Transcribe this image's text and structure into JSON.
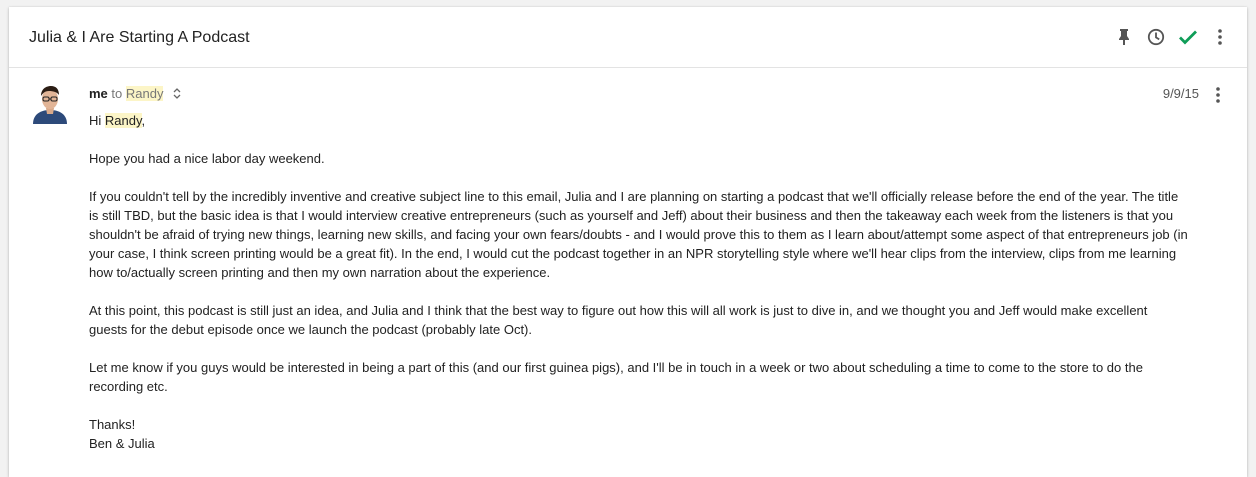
{
  "subject": "Julia & I Are Starting A Podcast",
  "header_actions": [
    "pin-icon",
    "snooze-clock-icon",
    "done-check-icon",
    "more-vert-icon"
  ],
  "colors": {
    "accent_check": "#0f9d58",
    "highlight": "#fcf5c7"
  },
  "message": {
    "from": "me",
    "to_word": "to",
    "to": "Randy",
    "date": "9/9/15",
    "greeting_prefix": "Hi",
    "greeting_name": "Randy",
    "greeting_suffix": ",",
    "paragraphs": [
      "Hope you had a nice labor day weekend.",
      "If you couldn't tell by the incredibly inventive and creative subject line to this email, Julia and I are planning on starting a podcast that we'll officially release before the end of the year. The title is still TBD, but the basic idea is that I would interview creative entrepreneurs (such as yourself and Jeff) about their business and then the takeaway each week from the listeners is that you shouldn't be afraid of trying new things, learning new skills, and facing your own fears/doubts - and I would prove this to them as I learn about/attempt some aspect of that entrepreneurs job (in your case, I think screen printing would be a great fit). In the end, I would cut the podcast together in an NPR storytelling style where we'll hear clips from the interview, clips from me learning how to/actually screen printing and then my own narration about the experience.",
      "At this point, this podcast is still just an idea, and Julia and I think that the best way to figure out how this will all work is just to dive in, and we thought you and Jeff would make excellent guests for the debut episode once we launch the podcast (probably late Oct).",
      "Let me know if you guys would be interested in being a part of this (and our first guinea pigs), and I'll be in touch in a week or two about scheduling a time to come to the store to do the recording etc."
    ],
    "signoff": "Thanks!",
    "signature": "Ben & Julia"
  }
}
